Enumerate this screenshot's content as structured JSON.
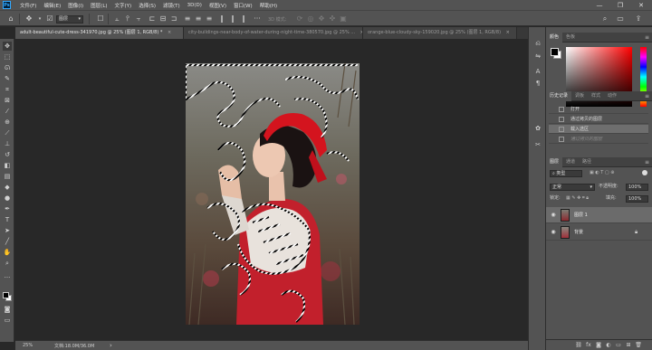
{
  "app": {
    "logo": "Ps"
  },
  "menu": [
    "文件(F)",
    "编辑(E)",
    "图像(I)",
    "图层(L)",
    "文字(Y)",
    "选择(S)",
    "滤镜(T)",
    "3D(D)",
    "视图(V)",
    "窗口(W)",
    "帮助(H)"
  ],
  "window_controls": {
    "minimize": "—",
    "restore": "❐",
    "close": "✕"
  },
  "options_bar": {
    "move_target": "图层",
    "mode_3d_label": "3D 模式:",
    "icons": [
      "home-icon",
      "move-tool-icon",
      "auto-select-checkbox",
      "align-icons",
      "3d-mode-icons",
      "search-icon",
      "workspace-icon",
      "share-icon"
    ]
  },
  "tabs": [
    {
      "label": "adult-beautiful-cute-dress-341970.jpg @ 25% (图层 1, RGB/8) *",
      "active": true,
      "close": "×"
    },
    {
      "label": "city-buildings-near-body-of-water-during-night-time-380570.jpg @ 25% ...",
      "active": false,
      "close": "×"
    },
    {
      "label": "orange-blue-cloudy-sky-159020.jpg @ 25% (图层 1, RGB/8)",
      "active": false,
      "close": "×"
    }
  ],
  "status_bar": {
    "zoom": "25%",
    "doc_info": "文档:18.0M/36.0M",
    "arrow": "›"
  },
  "color_panel": {
    "tabs": [
      "颜色",
      "色板"
    ]
  },
  "history_panel": {
    "tabs": [
      "历史记录",
      "调板",
      "样式",
      "动作"
    ],
    "items": [
      {
        "label": "打开",
        "state": "normal"
      },
      {
        "label": "通过拷贝的图层",
        "state": "normal"
      },
      {
        "label": "载入选区",
        "state": "selected"
      },
      {
        "label": "通过拷贝的图层",
        "state": "undone"
      }
    ]
  },
  "layers_panel": {
    "tabs": [
      "图层",
      "通道",
      "路径"
    ],
    "filter_kind": "类型",
    "blend_mode": "正常",
    "opacity_label": "不透明度:",
    "opacity_value": "100%",
    "lock_label": "锁定:",
    "fill_label": "填充:",
    "fill_value": "100%",
    "layers": [
      {
        "name": "图层 1",
        "selected": true,
        "locked": false
      },
      {
        "name": "背景",
        "selected": false,
        "locked": true
      }
    ]
  },
  "colors": {
    "foreground": "#000000",
    "background": "#ffffff",
    "selected_history": "#6e6e6e",
    "selected_layer": "#6b6b6b"
  }
}
